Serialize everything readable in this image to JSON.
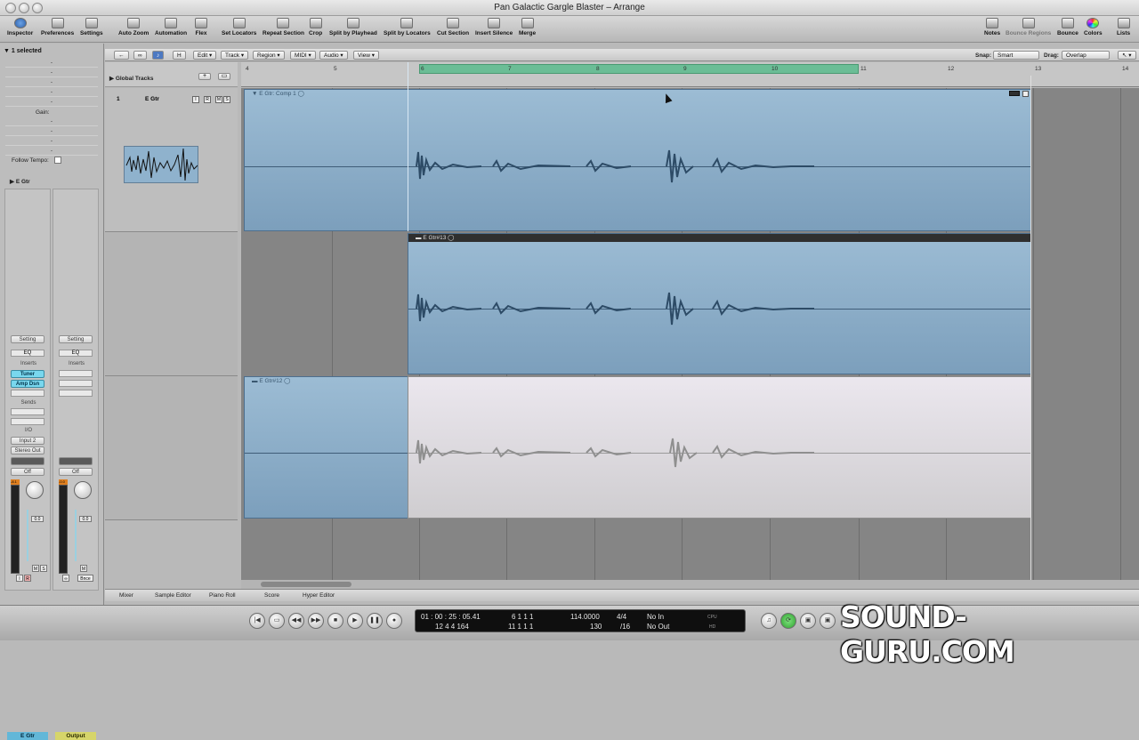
{
  "window": {
    "title": "Pan Galactic Gargle Blaster – Arrange"
  },
  "toolbar": {
    "items": [
      {
        "label": "Inspector"
      },
      {
        "label": "Preferences"
      },
      {
        "label": "Settings"
      },
      {
        "label": "Auto Zoom"
      },
      {
        "label": "Automation"
      },
      {
        "label": "Flex"
      },
      {
        "label": "Set Locators"
      },
      {
        "label": "Repeat Section"
      },
      {
        "label": "Crop"
      },
      {
        "label": "Split by Playhead"
      },
      {
        "label": "Split by Locators"
      },
      {
        "label": "Cut Section"
      },
      {
        "label": "Insert Silence"
      },
      {
        "label": "Merge"
      },
      {
        "label": "Notes"
      },
      {
        "label": "Bounce Regions"
      },
      {
        "label": "Bounce"
      },
      {
        "label": "Colors"
      },
      {
        "label": "Lists"
      }
    ]
  },
  "inspector": {
    "header": "1 selected",
    "gain_label": "Gain:",
    "follow_tempo_label": "Follow Tempo:",
    "track_section": "E Gtr",
    "placeholder": "-",
    "strip1": {
      "setting": "Setting",
      "eq": "EQ",
      "inserts_label": "Inserts",
      "insert1": "Tuner",
      "insert2": "Amp Dsn",
      "sends_label": "Sends",
      "io_label": "I/O",
      "input": "Input 2",
      "output": "Stereo Out",
      "automation": "Off",
      "meter_peak": "-8.1",
      "fader_value": "0.0",
      "name": "E Gtr",
      "mute": "M",
      "solo": "S",
      "record": "R",
      "input_monitor": "I"
    },
    "strip2": {
      "setting": "Setting",
      "eq": "EQ",
      "inserts_label": "Inserts",
      "automation": "Off",
      "meter_peak": "-0.0",
      "fader_value": "0.0",
      "name": "Output",
      "mute": "M",
      "bounce": "Bnce"
    }
  },
  "arrange": {
    "menus": [
      {
        "label": "Edit"
      },
      {
        "label": "Track"
      },
      {
        "label": "Region"
      },
      {
        "label": "MIDI"
      },
      {
        "label": "Audio"
      },
      {
        "label": "View"
      }
    ],
    "menu_symbols": {
      "back": "←",
      "link": "∞",
      "catch": "♪",
      "hide": "H"
    },
    "snap_label": "Snap:",
    "snap_value": "Smart",
    "drag_label": "Drag:",
    "drag_value": "Overlap",
    "global_tracks_label": "Global Tracks",
    "add_track": "+",
    "add_folder": "▭",
    "ruler_ticks": [
      "4",
      "5",
      "6",
      "7",
      "8",
      "9",
      "10",
      "11",
      "12",
      "13",
      "14"
    ],
    "track": {
      "number": "1",
      "name": "E Gtr",
      "buttons": [
        "I",
        "R",
        "M",
        "S"
      ]
    },
    "regions": [
      {
        "name": "E Gtr: Comp 1"
      },
      {
        "name": "E Gtr#13"
      },
      {
        "name": "E Gtr#12"
      }
    ]
  },
  "bottom_tabs": [
    "Mixer",
    "Sample Editor",
    "Piano Roll",
    "Score",
    "Hyper Editor"
  ],
  "transport": {
    "buttons": [
      "go-to-start",
      "rewind-step",
      "rewind",
      "fast-forward",
      "stop",
      "play",
      "pause",
      "record"
    ],
    "smpte": "01 : 00 : 25 : 05.41",
    "bars": "12   4   4   164",
    "pos1": "6   1   1   1",
    "pos2": "11   1   1   1",
    "tempo": "114.0000",
    "tempo2": "130",
    "signature": "4/4",
    "division": "/16",
    "in_label": "No In",
    "out_label": "No Out",
    "cpu_label": "CPU",
    "hd_label": "HD"
  },
  "watermark": "SOUND-GURU.COM"
}
